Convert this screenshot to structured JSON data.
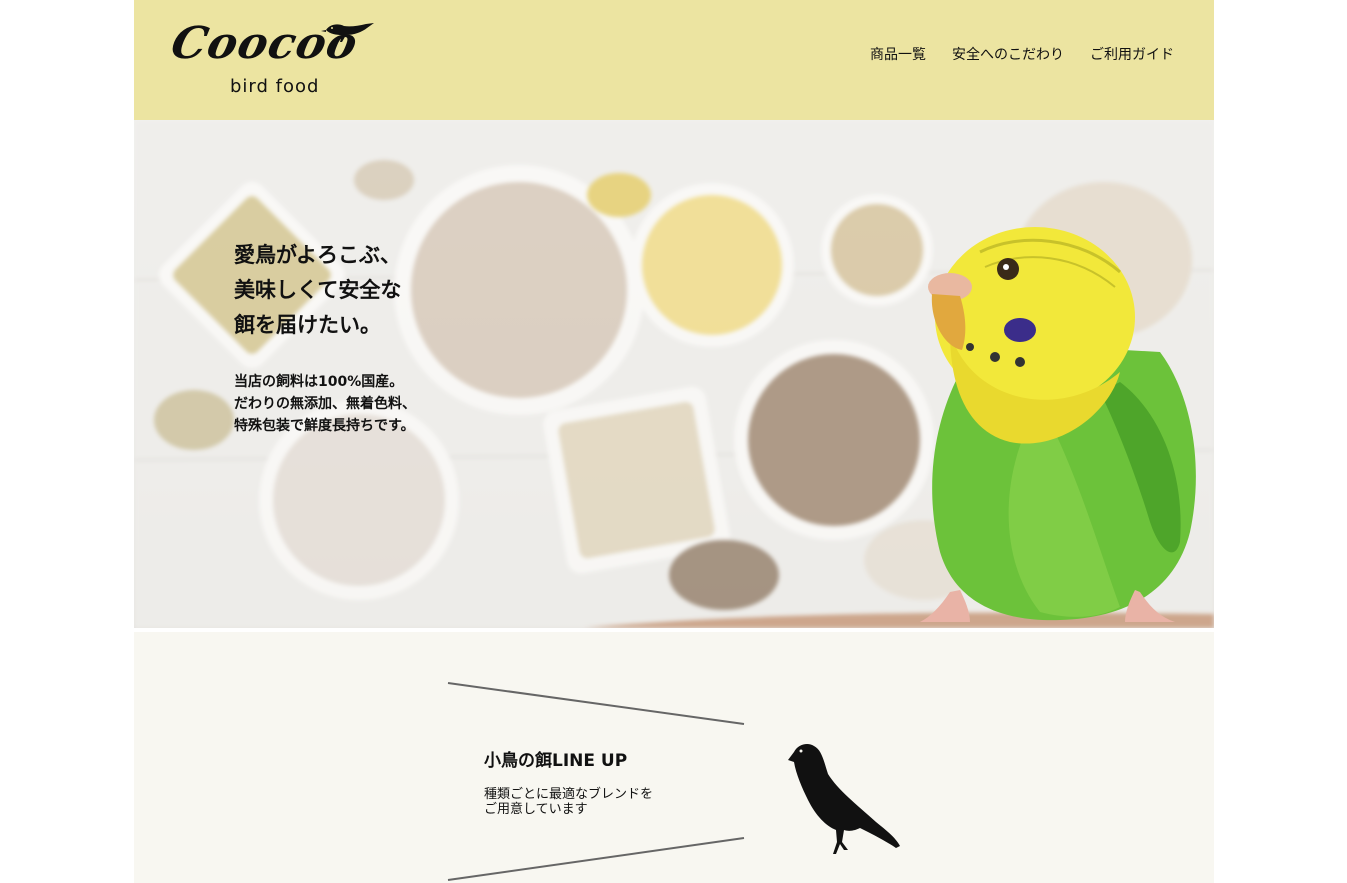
{
  "brand": {
    "logo_script": "Coocoo",
    "logo_sub": "bird food"
  },
  "nav": {
    "items": [
      {
        "label": "商品一覧"
      },
      {
        "label": "安全へのこだわり"
      },
      {
        "label": "ご利用ガイド"
      }
    ]
  },
  "hero": {
    "title_lines": [
      "愛鳥がよろこぶ、",
      "美味しくて安全な",
      "餌を届けたい。"
    ],
    "desc_lines": [
      "当店の飼料は100%国産。",
      "だわりの無添加、無着色料、",
      "特殊包装で鮮度長持ちです。"
    ]
  },
  "lineup": {
    "title": "小鳥の餌LINE UP",
    "desc_lines": [
      "種類ごとに最適なブレンドを",
      "ご用意しています"
    ]
  },
  "colors": {
    "header_bg": "#ece4a1",
    "lineup_bg": "#f8f7f1",
    "text": "#111111"
  }
}
